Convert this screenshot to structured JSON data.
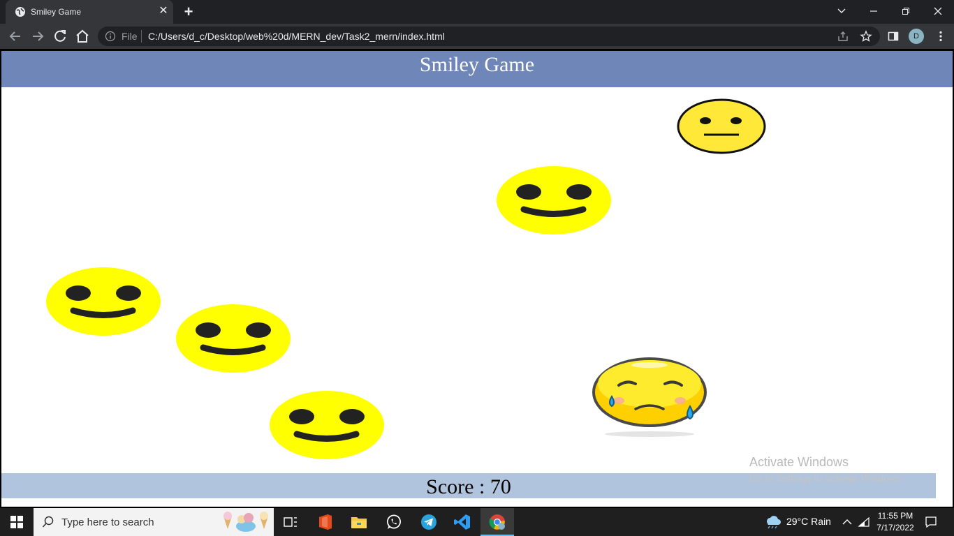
{
  "browser": {
    "tab_title": "Smiley Game",
    "tab_close": "✕",
    "new_tab": "+",
    "omnibox_scheme": "File",
    "url": "C:/Users/d_c/Desktop/web%20d/MERN_dev/Task2_mern/index.html",
    "avatar_letter": "D"
  },
  "page": {
    "title": "Smiley Game",
    "score_text": "Score : 70",
    "colors": {
      "header": "#6f87b8",
      "score_bar": "#b0c4de",
      "smiley": "#ffff00"
    }
  },
  "watermark": {
    "title": "Activate Windows",
    "subtitle": "Go to Settings to activate Windows."
  },
  "taskbar": {
    "search_placeholder": "Type here to search",
    "weather": "29°C  Rain",
    "time": "11:55 PM",
    "date": "7/17/2022"
  }
}
